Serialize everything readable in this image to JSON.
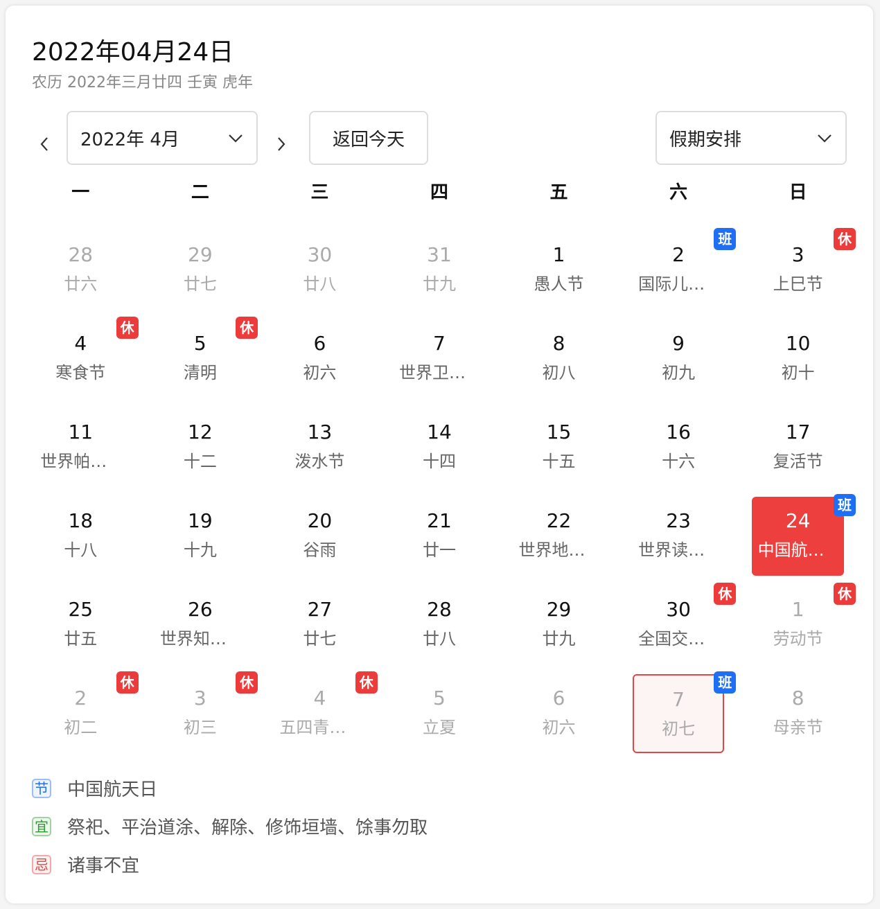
{
  "header": {
    "title": "2022年04月24日",
    "subtitle": "农历 2022年三月廿四 壬寅 虎年"
  },
  "toolbar": {
    "month_select": "2022年 4月",
    "today_button": "返回今天",
    "holiday_select": "假期安排"
  },
  "weekdays": [
    "一",
    "二",
    "三",
    "四",
    "五",
    "六",
    "日"
  ],
  "calendar": {
    "weeks": [
      [
        {
          "day": "28",
          "label": "廿六",
          "other": true
        },
        {
          "day": "29",
          "label": "廿七",
          "other": true
        },
        {
          "day": "30",
          "label": "廿八",
          "other": true
        },
        {
          "day": "31",
          "label": "廿九",
          "other": true
        },
        {
          "day": "1",
          "label": "愚人节"
        },
        {
          "day": "2",
          "label": "国际儿童图书日",
          "badge": "班",
          "badge_type": "work"
        },
        {
          "day": "3",
          "label": "上巳节",
          "badge": "休",
          "badge_type": "rest"
        }
      ],
      [
        {
          "day": "4",
          "label": "寒食节",
          "badge": "休",
          "badge_type": "rest"
        },
        {
          "day": "5",
          "label": "清明",
          "badge": "休",
          "badge_type": "rest"
        },
        {
          "day": "6",
          "label": "初六"
        },
        {
          "day": "7",
          "label": "世界卫生日"
        },
        {
          "day": "8",
          "label": "初八"
        },
        {
          "day": "9",
          "label": "初九"
        },
        {
          "day": "10",
          "label": "初十"
        }
      ],
      [
        {
          "day": "11",
          "label": "世界帕金森病日"
        },
        {
          "day": "12",
          "label": "十二"
        },
        {
          "day": "13",
          "label": "泼水节"
        },
        {
          "day": "14",
          "label": "十四"
        },
        {
          "day": "15",
          "label": "十五"
        },
        {
          "day": "16",
          "label": "十六"
        },
        {
          "day": "17",
          "label": "复活节"
        }
      ],
      [
        {
          "day": "18",
          "label": "十八"
        },
        {
          "day": "19",
          "label": "十九"
        },
        {
          "day": "20",
          "label": "谷雨"
        },
        {
          "day": "21",
          "label": "廿一"
        },
        {
          "day": "22",
          "label": "世界地球日"
        },
        {
          "day": "23",
          "label": "世界读书日"
        },
        {
          "day": "24",
          "label": "中国航天日",
          "badge": "班",
          "badge_type": "work",
          "selected": true
        }
      ],
      [
        {
          "day": "25",
          "label": "廿五"
        },
        {
          "day": "26",
          "label": "世界知识产权日"
        },
        {
          "day": "27",
          "label": "廿七"
        },
        {
          "day": "28",
          "label": "廿八"
        },
        {
          "day": "29",
          "label": "廿九"
        },
        {
          "day": "30",
          "label": "全国交通安全反思日",
          "badge": "休",
          "badge_type": "rest"
        },
        {
          "day": "1",
          "label": "劳动节",
          "badge": "休",
          "badge_type": "rest",
          "other": true
        }
      ],
      [
        {
          "day": "2",
          "label": "初二",
          "badge": "休",
          "badge_type": "rest",
          "other": true
        },
        {
          "day": "3",
          "label": "初三",
          "badge": "休",
          "badge_type": "rest",
          "other": true
        },
        {
          "day": "4",
          "label": "五四青年节",
          "badge": "休",
          "badge_type": "rest",
          "other": true
        },
        {
          "day": "5",
          "label": "立夏",
          "other": true
        },
        {
          "day": "6",
          "label": "初六",
          "other": true
        },
        {
          "day": "7",
          "label": "初七",
          "badge": "班",
          "badge_type": "work",
          "other": true,
          "outlined": true
        },
        {
          "day": "8",
          "label": "母亲节",
          "other": true
        }
      ]
    ]
  },
  "details": {
    "festival_tag": "节",
    "festival": "中国航天日",
    "yi_tag": "宜",
    "yi": "祭祀、平治道涂、解除、修饰垣墙、馀事勿取",
    "ji_tag": "忌",
    "ji": "诸事不宜"
  },
  "colors": {
    "rest_badge": "#ec3b3b",
    "work_badge": "#1f6ff5",
    "selected": "#ee3f3f"
  }
}
